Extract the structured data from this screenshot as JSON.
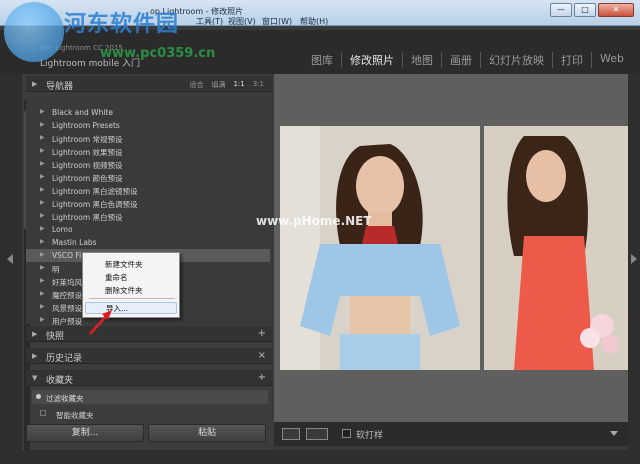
{
  "window": {
    "title": "op Lightroom - 修改照片",
    "buttons": [
      "—",
      "□",
      "✕"
    ]
  },
  "menubar": {
    "items": [
      "工具(T)",
      "视图(V)",
      "窗口(W)",
      "帮助(H)"
    ]
  },
  "watermark": {
    "site": "河东软件园",
    "url": "www.pc0359.cn",
    "mid": "www.pHome.NET"
  },
  "header": {
    "product_version": "obe Lightroom CC 2015",
    "identity": "Lightroom mobile 入门"
  },
  "modules": [
    "图库",
    "修改照片",
    "地图",
    "画册",
    "幻灯片放映",
    "打印",
    "Web"
  ],
  "navigator": {
    "label": "导航器",
    "options": [
      "适合",
      "填满",
      "1:1",
      "3:1"
    ]
  },
  "presets": [
    "Black and White",
    "Lightroom Presets",
    "Lightroom 常规预设",
    "Lightroom 效果预设",
    "Lightroom 视频预设",
    "Lightroom 颜色预设",
    "Lightroom 黑白滤镜预设",
    "Lightroom 黑白色调预设",
    "Lightroom 黑白预设",
    "Lomo",
    "Mastin Labs",
    "VSCO Film 00",
    "明",
    "好莱坞风",
    "魔控预设",
    "风景预设",
    "用户预设"
  ],
  "context_menu": {
    "items": [
      "新建文件夹",
      "重命名",
      "删除文件夹",
      "导入..."
    ]
  },
  "panels": {
    "snapshots": "快照",
    "history": "历史记录",
    "collections": "收藏夹",
    "filter": "过滤收藏夹",
    "smart": "智能收藏夹"
  },
  "bottom_buttons": {
    "copy": "复制...",
    "paste": "粘贴"
  },
  "toolbar": {
    "soft_proof": "软打样"
  }
}
